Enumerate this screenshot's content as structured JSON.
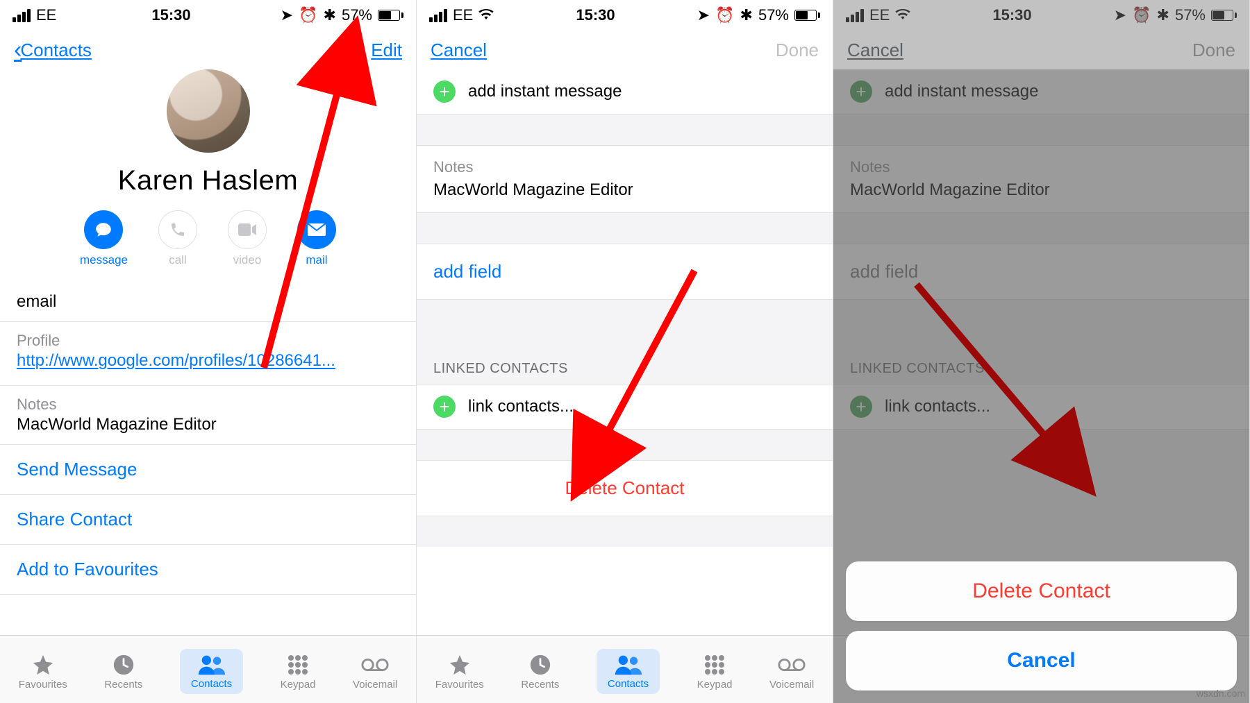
{
  "status": {
    "carrier": "EE",
    "time": "15:30",
    "battery": "57%"
  },
  "screen1": {
    "back": "Contacts",
    "edit": "Edit",
    "name": "Karen Haslem",
    "actions": {
      "message": "message",
      "call": "call",
      "video": "video",
      "mail": "mail"
    },
    "email_label": "email",
    "profile_label": "Profile",
    "profile_url": "http://www.google.com/profiles/10286641...",
    "notes_label": "Notes",
    "notes_text": "MacWorld Magazine Editor",
    "send_message": "Send Message",
    "share_contact": "Share Contact",
    "add_favourites": "Add to Favourites"
  },
  "screen2": {
    "cancel": "Cancel",
    "done": "Done",
    "add_im": "add instant message",
    "notes_label": "Notes",
    "notes_text": "MacWorld Magazine Editor",
    "add_field": "add field",
    "linked_header": "LINKED CONTACTS",
    "link_contacts": "link contacts...",
    "delete": "Delete Contact"
  },
  "screen3": {
    "cancel": "Cancel",
    "done": "Done",
    "add_im": "add instant message",
    "notes_label": "Notes",
    "notes_text": "MacWorld Magazine Editor",
    "add_field": "add field",
    "linked_header": "LINKED CONTACTS",
    "link_contacts": "link contacts...",
    "sheet_delete": "Delete Contact",
    "sheet_cancel": "Cancel"
  },
  "tabs": {
    "favourites": "Favourites",
    "recents": "Recents",
    "contacts": "Contacts",
    "keypad": "Keypad",
    "voicemail": "Voicemail"
  },
  "watermark": "wsxdn.com"
}
